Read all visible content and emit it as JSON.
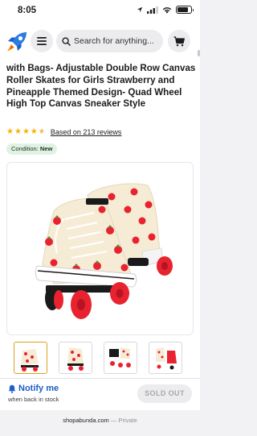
{
  "status_bar": {
    "time": "8:05",
    "icons": [
      "location-arrow-icon",
      "signal-icon",
      "wifi-icon",
      "battery-icon"
    ]
  },
  "header": {
    "logo_icon": "rocket-icon",
    "menu_icon": "menu-icon",
    "search_placeholder": "Search for anything...",
    "cart_icon": "cart-icon"
  },
  "product": {
    "title": "with Bags- Adjustable Double Row Canvas Roller Skates for Girls Strawberry and Pineapple Themed Design- Quad Wheel High Top Canvas Sneaker Style",
    "rating": 4.5,
    "reviews_text": "Based on 213 reviews",
    "condition_label": "Condition:",
    "condition_value": "New",
    "image_alt_subject": "strawberry-print-roller-skates",
    "thumbnail_count": 4
  },
  "footer": {
    "notify_label": "Notify me",
    "notify_sub": "when back in stock",
    "sold_out_label": "SOLD OUT"
  },
  "browser": {
    "domain": "shopabunda.com",
    "separator": "—",
    "mode": "Private"
  },
  "colors": {
    "accent_blue": "#1f5fc9",
    "star_gold": "#f5b301",
    "badge_green": "#dff3e3",
    "wheel_red": "#e8232f"
  }
}
